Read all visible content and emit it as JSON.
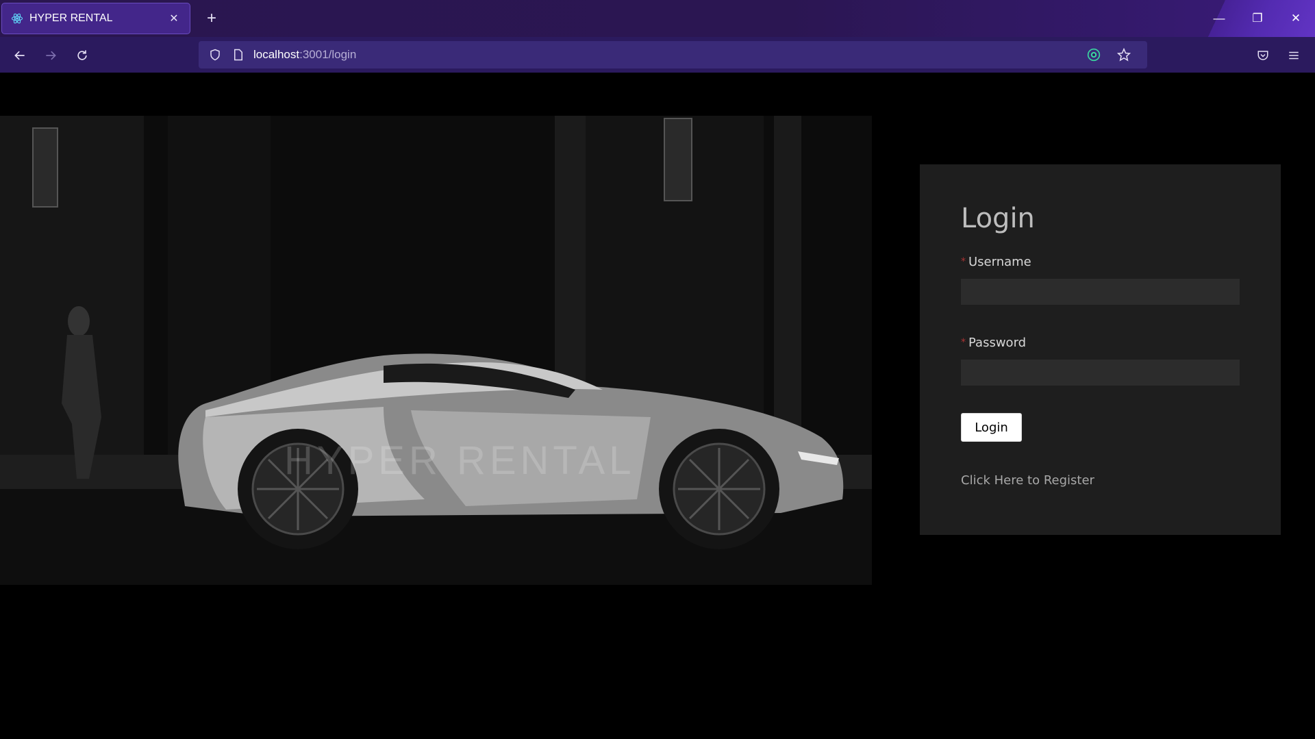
{
  "browser": {
    "tab_title": "HYPER RENTAL",
    "url_host": "localhost",
    "url_path": ":3001/login",
    "icons": [
      "react-icon",
      "close-icon",
      "plus-icon",
      "back-arrow-icon",
      "forward-arrow-icon",
      "reload-icon",
      "shield-icon",
      "page-icon",
      "extension-icon",
      "star-icon",
      "pocket-icon",
      "menu-icon",
      "minimize-icon",
      "restore-icon",
      "close-window-icon"
    ],
    "accent": "#2b1a5e"
  },
  "hero": {
    "brand_overlay": "HYPER RENTAL"
  },
  "login": {
    "title": "Login",
    "username_label": "Username",
    "password_label": "Password",
    "required_mark": "*",
    "submit_label": "Login",
    "register_link": "Click Here to Register"
  }
}
